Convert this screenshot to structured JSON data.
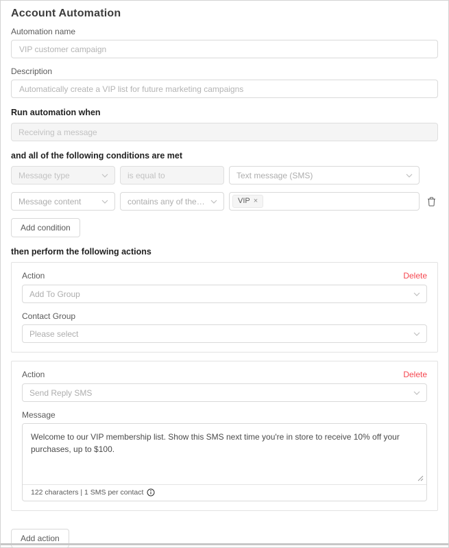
{
  "page": {
    "title": "Account Automation"
  },
  "icons": {
    "tag_remove": "×"
  },
  "name_field": {
    "label": "Automation name",
    "value": "VIP customer campaign"
  },
  "description_field": {
    "label": "Description",
    "value": "Automatically create a VIP list for future marketing campaigns"
  },
  "trigger": {
    "heading": "Run automation when",
    "value": "Receiving a message"
  },
  "conditions": {
    "heading": "and all of the following conditions are met",
    "row1": {
      "field": "Message type",
      "operator": "is equal to",
      "value": "Text message (SMS)"
    },
    "row2": {
      "field": "Message content",
      "operator": "contains any of the followi...",
      "tag": "VIP"
    },
    "add_button": "Add condition"
  },
  "actions_section": {
    "heading": "then perform the following actions",
    "add_button": "Add action",
    "card1": {
      "action_label": "Action",
      "delete_label": "Delete",
      "action_value": "Add To Group",
      "group_label": "Contact Group",
      "group_value": "Please select"
    },
    "card2": {
      "action_label": "Action",
      "delete_label": "Delete",
      "action_value": "Send Reply SMS",
      "message_label": "Message",
      "message_value": "Welcome to our VIP membership list. Show this SMS next time you're in store to receive 10% off your purchases, up to $100.",
      "footer_text": "122 characters | 1 SMS per contact"
    }
  },
  "colors": {
    "delete_red": "#f5464f",
    "border_gray": "#d9d9d9",
    "disabled_bg": "#f5f5f5"
  }
}
